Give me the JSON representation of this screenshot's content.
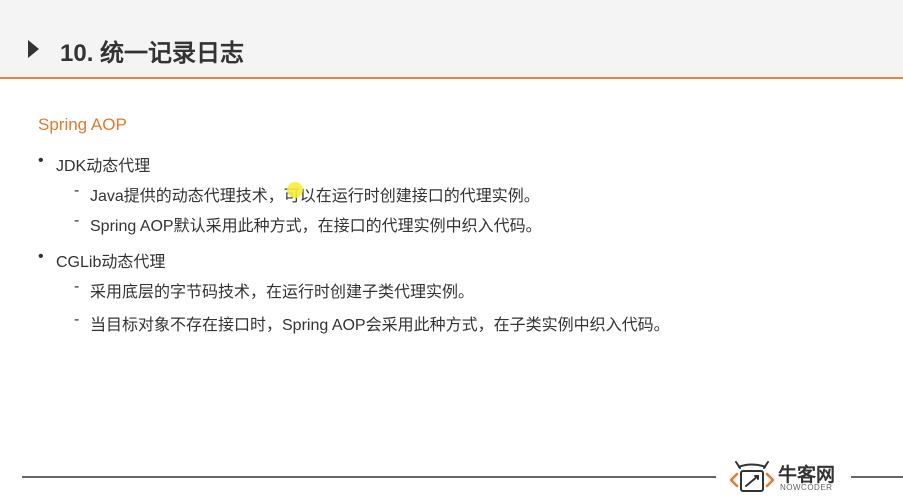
{
  "header": {
    "title": "10. 统一记录日志"
  },
  "content": {
    "section_title": "Spring AOP",
    "groups": [
      {
        "label": "JDK动态代理",
        "items": [
          "Java提供的动态代理技术，可以在运行时创建接口的代理实例。",
          "Spring AOP默认采用此种方式，在接口的代理实例中织入代码。"
        ]
      },
      {
        "label": "CGLib动态代理",
        "items": [
          "采用底层的字节码技术，在运行时创建子类代理实例。",
          "当目标对象不存在接口时，Spring AOP会采用此种方式，在子类实例中织入代码。"
        ]
      }
    ]
  },
  "footer": {
    "logo_cn": "牛客网",
    "logo_en": "NOWCODER"
  },
  "colors": {
    "accent": "#e07a2f",
    "header_rule": "#e8823c",
    "cursor_highlight": "#f7ec3a"
  },
  "icons": {
    "header_marker": "triangle-right-icon",
    "logo": "nowcoder-logo-icon"
  }
}
